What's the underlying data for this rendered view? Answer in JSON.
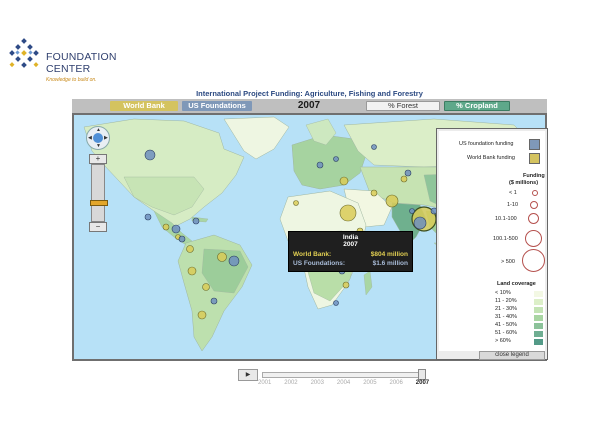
{
  "brand": {
    "name_line1": "FOUNDATION",
    "name_line2": "CENTER",
    "tagline": "Knowledge to build on."
  },
  "app_title": "International Project Funding: Agriculture, Fishing and Forestry",
  "toolbar": {
    "world_bank_label": "World Bank",
    "us_foundations_label": "US Foundations",
    "year": "2007",
    "forest_label": "% Forest",
    "cropland_label": "% Cropland"
  },
  "colors": {
    "world_bank": "#d4c35f",
    "us_foundations": "#7f98b8",
    "cropland_active": "#5ea88a",
    "ocean": "#b7e1f7"
  },
  "map_control": {
    "pan_icon": "compass-icon",
    "zoom_in_label": "+",
    "zoom_out_label": "−",
    "zoom_level": 0.3
  },
  "tooltip": {
    "country": "India",
    "year": "2007",
    "world_bank_label": "World Bank:",
    "world_bank_value": "$804 million",
    "us_foundations_label": "US Foundations:",
    "us_foundations_value": "$1.6 million"
  },
  "legend": {
    "us_foundation_funding": "US foundation funding",
    "world_bank_funding": "World Bank funding",
    "funding_title_1": "Funding",
    "funding_title_2": "($ millions)",
    "funding_levels": [
      "< 1",
      "1-10",
      "10.1-100",
      "100.1-500",
      "> 500"
    ],
    "land_coverage_title": "Land coverage",
    "coverage_levels": [
      "< 10%",
      "11 - 20%",
      "21 - 30%",
      "31 - 40%",
      "41 - 50%",
      "51 - 60%",
      "> 60%"
    ],
    "coverage_colors": [
      "#f3f8e4",
      "#dcefc8",
      "#c3e3b4",
      "#a8d5a2",
      "#8cc29a",
      "#6fae92",
      "#539a87"
    ],
    "close_label": "close legend"
  },
  "timeline": {
    "play_icon": "play-icon",
    "years": [
      "2001",
      "2002",
      "2003",
      "2004",
      "2005",
      "2006",
      "2007"
    ],
    "selected_year": "2007"
  }
}
